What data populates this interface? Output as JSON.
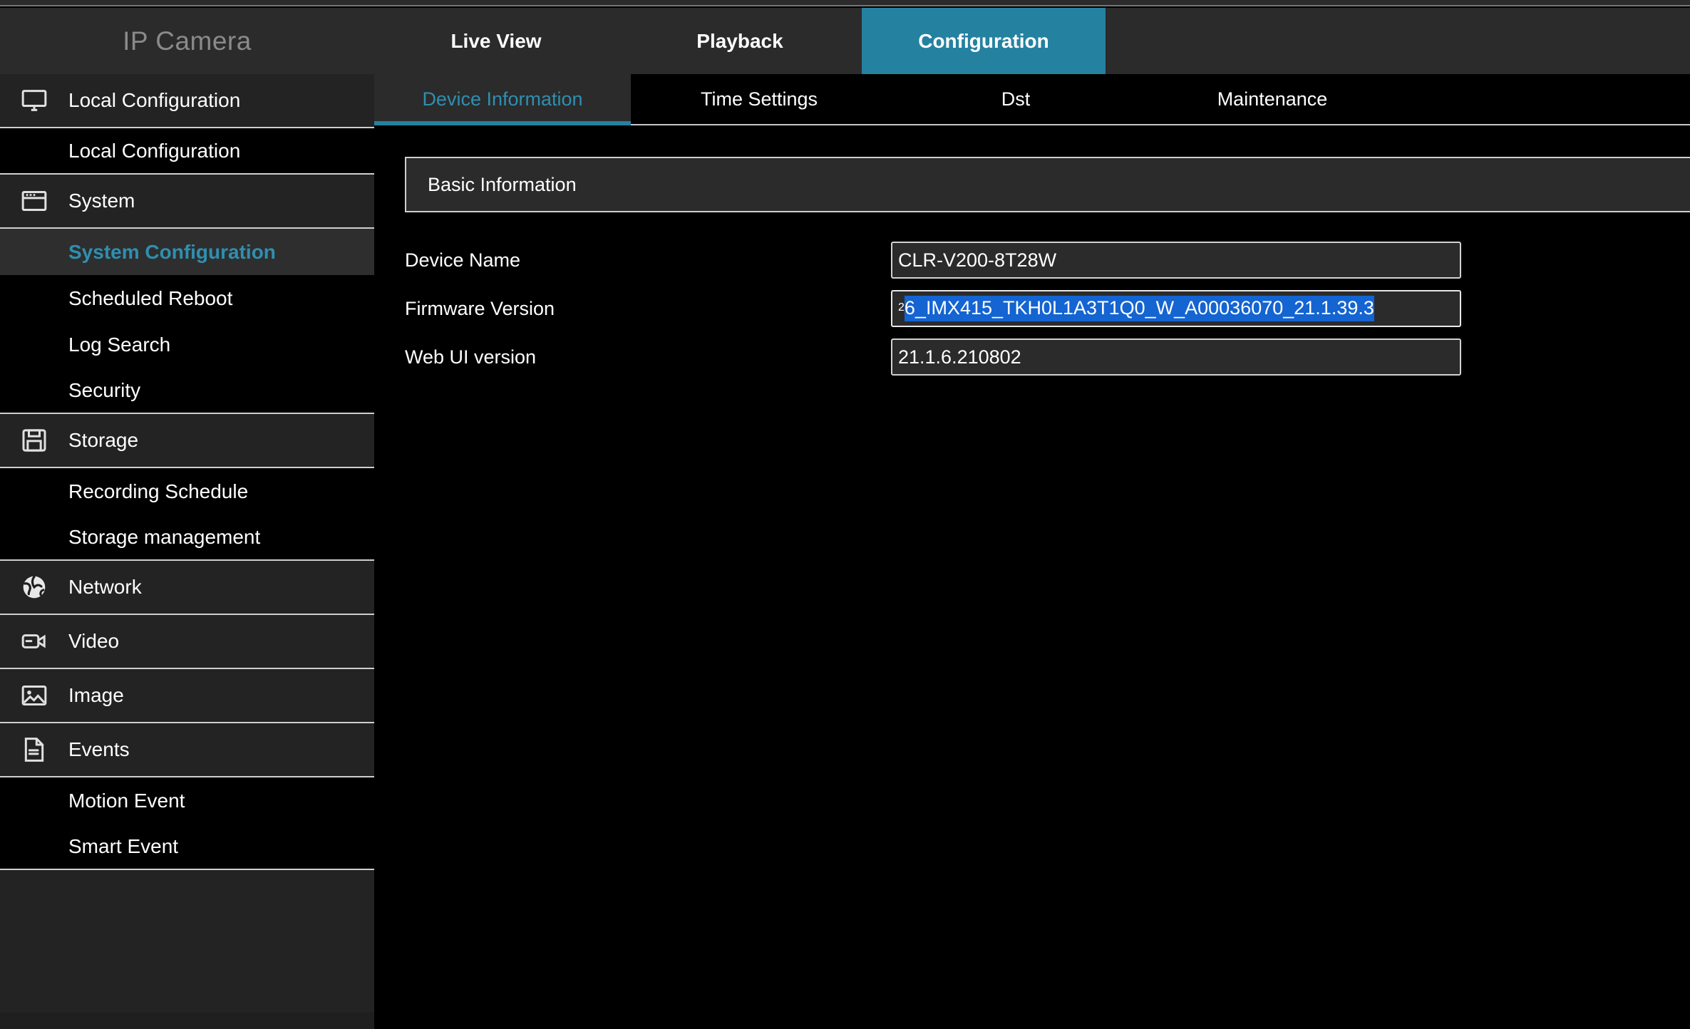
{
  "header": {
    "brand": "IP Camera",
    "tabs": [
      {
        "label": "Live View",
        "active": false
      },
      {
        "label": "Playback",
        "active": false
      },
      {
        "label": "Configuration",
        "active": true
      }
    ]
  },
  "subtabs": [
    {
      "label": "Device Information",
      "active": true
    },
    {
      "label": "Time Settings",
      "active": false
    },
    {
      "label": "Dst",
      "active": false
    },
    {
      "label": "Maintenance",
      "active": false
    }
  ],
  "sidebar": {
    "items": [
      {
        "label": "Local Configuration",
        "type": "parent",
        "icon": "monitor-icon",
        "selected": false
      },
      {
        "label": "Local Configuration",
        "type": "child",
        "icon": "",
        "selected": false,
        "last": true
      },
      {
        "label": "System",
        "type": "parent",
        "icon": "window-icon",
        "selected": false
      },
      {
        "label": "System Configuration",
        "type": "child",
        "icon": "",
        "selected": true,
        "last": false
      },
      {
        "label": "Scheduled Reboot",
        "type": "child",
        "icon": "",
        "selected": false,
        "last": false
      },
      {
        "label": "Log Search",
        "type": "child",
        "icon": "",
        "selected": false,
        "last": false
      },
      {
        "label": "Security",
        "type": "child",
        "icon": "",
        "selected": false,
        "last": true
      },
      {
        "label": "Storage",
        "type": "parent",
        "icon": "floppy-disk-icon",
        "selected": false
      },
      {
        "label": "Recording Schedule",
        "type": "child",
        "icon": "",
        "selected": false,
        "last": false
      },
      {
        "label": "Storage management",
        "type": "child",
        "icon": "",
        "selected": false,
        "last": true
      },
      {
        "label": "Network",
        "type": "parent",
        "icon": "globe-icon",
        "selected": false
      },
      {
        "label": "Video",
        "type": "parent",
        "icon": "camcorder-icon",
        "selected": false
      },
      {
        "label": "Image",
        "type": "parent",
        "icon": "picture-icon",
        "selected": false
      },
      {
        "label": "Events",
        "type": "parent",
        "icon": "document-icon",
        "selected": false
      },
      {
        "label": "Motion Event",
        "type": "child",
        "icon": "",
        "selected": false,
        "last": false
      },
      {
        "label": "Smart Event",
        "type": "child",
        "icon": "",
        "selected": false,
        "last": true
      }
    ]
  },
  "main": {
    "panel_title": "Basic Information",
    "fields": [
      {
        "label": "Device Name",
        "value": "CLR-V200-8T28W",
        "state": "normal"
      },
      {
        "label": "Firmware Version",
        "value": "26_IMX415_TKH0L1A3T1Q0_W_A00036070_21.1.39.3",
        "value_head": "2",
        "value_selected": "6_IMX415_TKH0L1A3T1Q0_W_A00036070_21.1.39.3",
        "state": "focused-selected"
      },
      {
        "label": "Web UI version",
        "value": "21.1.6.210802",
        "state": "normal"
      }
    ]
  },
  "colors": {
    "accent": "#2581a0",
    "accent_text": "#2f8fb0",
    "selection_blue": "#1464d2",
    "header_bg": "#2b2b2b",
    "sidebar_parent_bg": "#232323",
    "content_bg": "#000000",
    "brand_text": "#8a8a8a"
  }
}
